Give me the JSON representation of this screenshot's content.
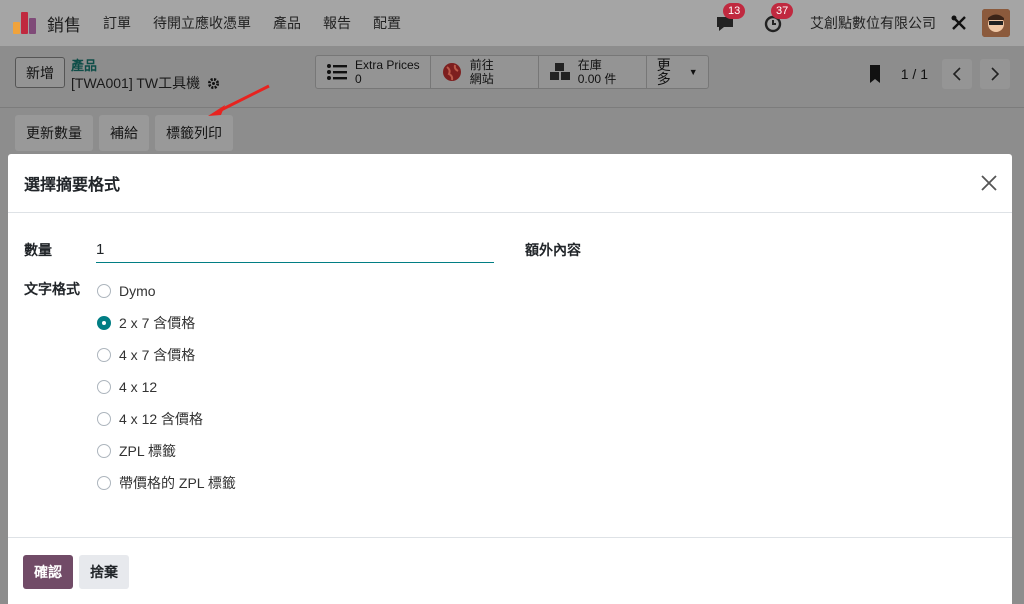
{
  "navbar": {
    "app_name": "銷售",
    "menu": [
      "訂單",
      "待開立應收憑單",
      "產品",
      "報告",
      "配置"
    ],
    "messages_count": "13",
    "activities_count": "37",
    "company": "艾創點數位有限公司"
  },
  "control": {
    "new_label": "新增",
    "breadcrumb": "產品",
    "record_title": "[TWA001] TW工具機",
    "smart_buttons": [
      {
        "line1": "Extra Prices",
        "line2": "0",
        "icon": "list-icon"
      },
      {
        "line1": "前往",
        "line2": "網站",
        "icon": "globe-icon"
      },
      {
        "line1": "在庫",
        "line2": "0.00 件",
        "icon": "boxes-icon"
      }
    ],
    "more_label": "更多",
    "pager": "1 / 1"
  },
  "actions": [
    "更新數量",
    "補給",
    "標籤列印"
  ],
  "modal": {
    "title": "選擇摘要格式",
    "quantity_label": "數量",
    "quantity_value": "1",
    "extra_content_label": "額外內容",
    "format_label": "文字格式",
    "formats": [
      {
        "label": "Dymo",
        "checked": false
      },
      {
        "label": "2 x 7 含價格",
        "checked": true
      },
      {
        "label": "4 x 7 含價格",
        "checked": false
      },
      {
        "label": "4 x 12",
        "checked": false
      },
      {
        "label": "4 x 12 含價格",
        "checked": false
      },
      {
        "label": "ZPL 標籤",
        "checked": false
      },
      {
        "label": "帶價格的 ZPL 標籤",
        "checked": false
      }
    ],
    "confirm_label": "確認",
    "discard_label": "捨棄"
  },
  "colors": {
    "primary": "#714b67",
    "accent": "#017e84",
    "badge": "#c0293f",
    "annotation_arrow": "#e8231f"
  }
}
